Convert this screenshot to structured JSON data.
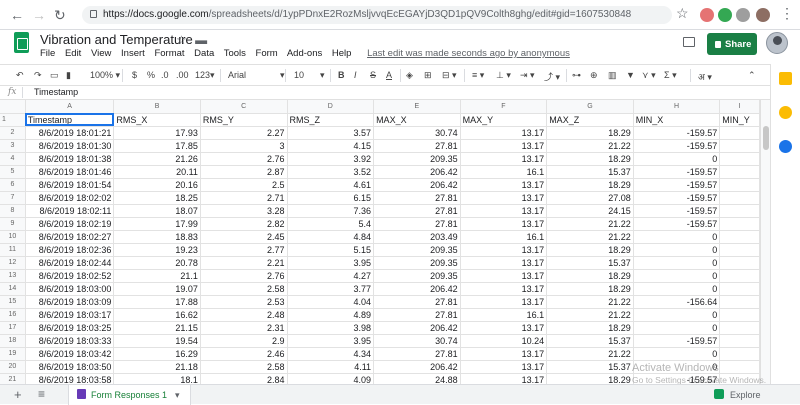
{
  "browser": {
    "url_domain": "https://docs.google.com",
    "url_path": "/spreadsheets/d/1ypPDnxE2RozMsljvvqEcEGAYjD3QD1pQV9Colth8ghg/edit#gid=1607530848"
  },
  "doc": {
    "title": "Vibration and Temperature",
    "last_edit": "Last edit was made seconds ago by anonymous",
    "share_label": "Share"
  },
  "menu": [
    "File",
    "Edit",
    "View",
    "Insert",
    "Format",
    "Data",
    "Tools",
    "Form",
    "Add-ons",
    "Help"
  ],
  "toolbar": {
    "zoom": "100%",
    "currency": "$",
    "percent": "%",
    "dec_less": ".0",
    "dec_more": ".00",
    "number_format": "123",
    "font": "Arial",
    "font_size": "10",
    "bold": "B",
    "italic": "I",
    "strike": "S",
    "text_color": "A",
    "sigma": "Σ",
    "input_tools": "अ"
  },
  "formula_bar": {
    "fx": "fx",
    "value": "Timestamp"
  },
  "grid": {
    "col_letters": [
      "A",
      "B",
      "C",
      "D",
      "E",
      "F",
      "G",
      "H",
      "I"
    ],
    "headers": [
      "Timestamp",
      "RMS_X",
      "RMS_Y",
      "RMS_Z",
      "MAX_X",
      "MAX_Y",
      "MAX_Z",
      "MIN_X",
      "MIN_Y"
    ],
    "rows": [
      [
        "8/6/2019 18:01:21",
        "17.93",
        "2.27",
        "3.57",
        "30.74",
        "13.17",
        "18.29",
        "-159.57",
        ""
      ],
      [
        "8/6/2019 18:01:30",
        "17.85",
        "3",
        "4.15",
        "27.81",
        "13.17",
        "21.22",
        "-159.57",
        ""
      ],
      [
        "8/6/2019 18:01:38",
        "21.26",
        "2.76",
        "3.92",
        "209.35",
        "13.17",
        "18.29",
        "0",
        ""
      ],
      [
        "8/6/2019 18:01:46",
        "20.11",
        "2.87",
        "3.52",
        "206.42",
        "16.1",
        "15.37",
        "-159.57",
        ""
      ],
      [
        "8/6/2019 18:01:54",
        "20.16",
        "2.5",
        "4.61",
        "206.42",
        "13.17",
        "18.29",
        "-159.57",
        ""
      ],
      [
        "8/6/2019 18:02:02",
        "18.25",
        "2.71",
        "6.15",
        "27.81",
        "13.17",
        "27.08",
        "-159.57",
        ""
      ],
      [
        "8/6/2019 18:02:11",
        "18.07",
        "3.28",
        "7.36",
        "27.81",
        "13.17",
        "24.15",
        "-159.57",
        ""
      ],
      [
        "8/6/2019 18:02:19",
        "17.99",
        "2.82",
        "5.4",
        "27.81",
        "13.17",
        "21.22",
        "-159.57",
        ""
      ],
      [
        "8/6/2019 18:02:27",
        "18.83",
        "2.45",
        "4.84",
        "203.49",
        "16.1",
        "21.22",
        "0",
        ""
      ],
      [
        "8/6/2019 18:02:36",
        "19.23",
        "2.77",
        "5.15",
        "209.35",
        "13.17",
        "18.29",
        "0",
        ""
      ],
      [
        "8/6/2019 18:02:44",
        "20.78",
        "2.21",
        "3.95",
        "209.35",
        "13.17",
        "15.37",
        "0",
        ""
      ],
      [
        "8/6/2019 18:02:52",
        "21.1",
        "2.76",
        "4.27",
        "209.35",
        "13.17",
        "18.29",
        "0",
        ""
      ],
      [
        "8/6/2019 18:03:00",
        "19.07",
        "2.58",
        "3.77",
        "206.42",
        "13.17",
        "18.29",
        "0",
        ""
      ],
      [
        "8/6/2019 18:03:09",
        "17.88",
        "2.53",
        "4.04",
        "27.81",
        "13.17",
        "21.22",
        "-156.64",
        ""
      ],
      [
        "8/6/2019 18:03:17",
        "16.62",
        "2.48",
        "4.89",
        "27.81",
        "16.1",
        "21.22",
        "0",
        ""
      ],
      [
        "8/6/2019 18:03:25",
        "21.15",
        "2.31",
        "3.98",
        "206.42",
        "13.17",
        "18.29",
        "0",
        ""
      ],
      [
        "8/6/2019 18:03:33",
        "19.54",
        "2.9",
        "3.95",
        "30.74",
        "10.24",
        "15.37",
        "-159.57",
        ""
      ],
      [
        "8/6/2019 18:03:42",
        "16.29",
        "2.46",
        "4.34",
        "27.81",
        "13.17",
        "21.22",
        "0",
        ""
      ],
      [
        "8/6/2019 18:03:50",
        "21.18",
        "2.58",
        "4.11",
        "206.42",
        "13.17",
        "15.37",
        "0",
        ""
      ],
      [
        "8/6/2019 18:03:58",
        "18.1",
        "2.84",
        "4.09",
        "24.88",
        "13.17",
        "18.29",
        "-159.57",
        ""
      ]
    ]
  },
  "sheet_tabs": {
    "add": "+",
    "list": "≡",
    "active_tab": "Form Responses 1",
    "explore": "Explore"
  },
  "watermark": {
    "line1": "Activate Windows",
    "line2": "Go to Settings to activate Windows."
  },
  "colors": {
    "share": "#1a7f45",
    "sheets_green": "#0f9d58",
    "selection": "#1a73e8"
  }
}
